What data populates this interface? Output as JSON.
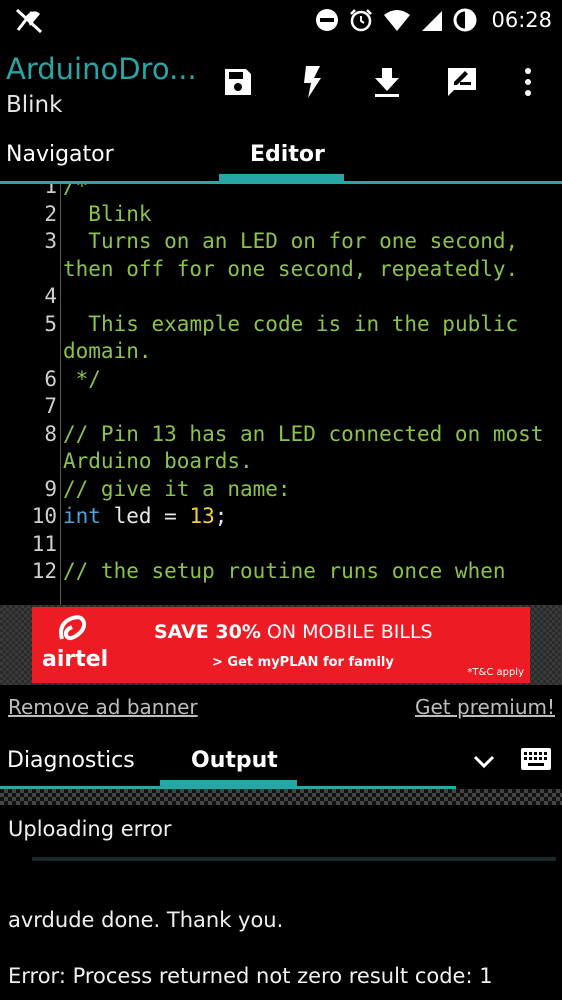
{
  "status": {
    "time": "06:28"
  },
  "appbar": {
    "title": "ArduinoDro...",
    "subtitle": "Blink"
  },
  "tabs": [
    {
      "label": "Navigator"
    },
    {
      "label": "Editor"
    }
  ],
  "editor": {
    "lines": [
      {
        "n": "1",
        "text": "/*"
      },
      {
        "n": "2",
        "text": "  Blink"
      },
      {
        "n": "3",
        "text": "  Turns on an LED on for one second, then off for one second, repeatedly."
      },
      {
        "n": "4",
        "text": ""
      },
      {
        "n": "5",
        "text": "  This example code is in the public domain."
      },
      {
        "n": "6",
        "text": " */"
      },
      {
        "n": "7",
        "text": ""
      },
      {
        "n": "8",
        "text": "// Pin 13 has an LED connected on most Arduino boards."
      },
      {
        "n": "9",
        "text": "// give it a name:"
      },
      {
        "n": "10",
        "kw": "int",
        "ident": " led ",
        "op": "=",
        "num": " 13",
        "end": ";"
      },
      {
        "n": "11",
        "text": ""
      },
      {
        "n": "12",
        "text": "// the setup routine runs once when"
      }
    ]
  },
  "ad": {
    "brand": "airtel",
    "headline_bold": "SAVE 30%",
    "headline_rest": " ON MOBILE BILLS",
    "sub": "> Get myPLAN for family",
    "tc": "*T&C apply"
  },
  "adlinks": {
    "remove": "Remove ad banner",
    "premium": "Get premium!"
  },
  "bottom_tabs": [
    {
      "label": "Diagnostics"
    },
    {
      "label": "Output"
    }
  ],
  "output": {
    "lines": [
      "Uploading error",
      "avrdude done.  Thank you.",
      "Error: Process returned not zero result code: 1"
    ]
  },
  "colors": {
    "accent": "#26a6a5",
    "comment": "#8bc34a",
    "keyword": "#4aa3df",
    "number": "#f4d03f",
    "ad_red": "#ed1c24"
  }
}
